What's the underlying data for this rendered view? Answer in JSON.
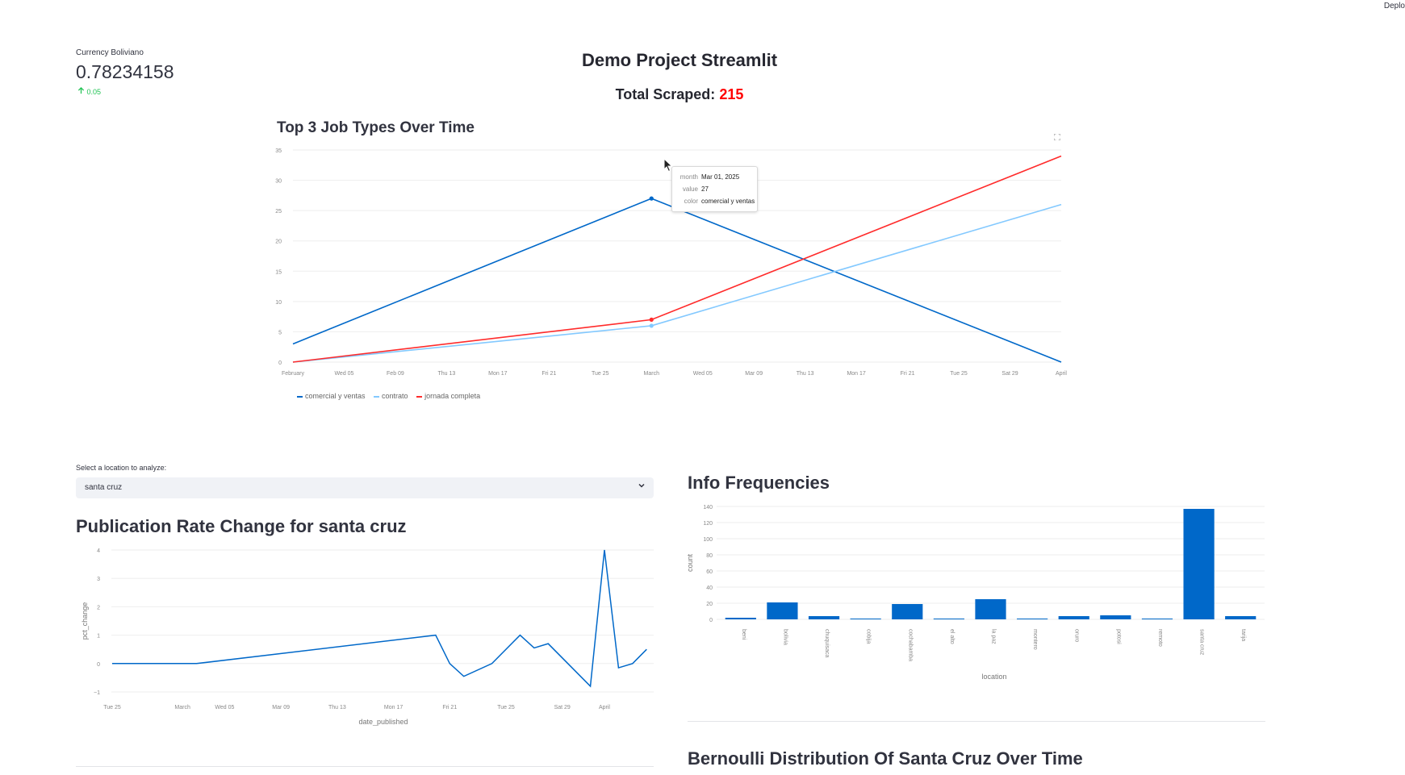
{
  "header": {
    "deploy_label": "Deplo"
  },
  "metric": {
    "label": "Currency Boliviano",
    "value": "0.78234158",
    "delta": "0.05",
    "delta_icon": "arrow-up-icon"
  },
  "page": {
    "title": "Demo Project Streamlit",
    "scraped_label": "Total Scraped:",
    "scraped_value": "215"
  },
  "top_chart": {
    "title": "Top 3 Job Types Over Time",
    "tooltip": {
      "k1": "month",
      "v1": "Mar 01, 2025",
      "k2": "value",
      "v2": "27",
      "k3": "color",
      "v3": "comercial y ventas"
    },
    "legend": [
      "comercial y ventas",
      "contrato",
      "jornada completa"
    ],
    "colors": [
      "#0068c9",
      "#83c9ff",
      "#ff2b2b"
    ]
  },
  "location_select": {
    "label": "Select a location to analyze:",
    "value": "santa cruz"
  },
  "pub_chart": {
    "title": "Publication Rate Change for santa cruz"
  },
  "freq_chart": {
    "title": "Info Frequencies"
  },
  "bernoulli": {
    "title": "Bernoulli Distribution Of Santa Cruz Over Time"
  },
  "chart_data": [
    {
      "type": "line",
      "title": "Top 3 Job Types Over Time",
      "x_ticks": [
        "February",
        "Wed 05",
        "Feb 09",
        "Thu 13",
        "Mon 17",
        "Fri 21",
        "Tue 25",
        "March",
        "Wed 05",
        "Mar 09",
        "Thu 13",
        "Mon 17",
        "Fri 21",
        "Tue 25",
        "Sat 29",
        "April"
      ],
      "x": [
        "Feb 01, 2025",
        "Mar 01, 2025",
        "Apr 01, 2025"
      ],
      "ylim": [
        0,
        35
      ],
      "y_ticks": [
        0,
        5,
        10,
        15,
        20,
        25,
        30,
        35
      ],
      "series": [
        {
          "name": "comercial y ventas",
          "values": [
            3,
            27,
            0
          ]
        },
        {
          "name": "contrato",
          "values": [
            0,
            6,
            26
          ]
        },
        {
          "name": "jornada completa",
          "values": [
            0,
            7,
            34
          ]
        }
      ]
    },
    {
      "type": "line",
      "title": "Publication Rate Change for santa cruz",
      "xlabel": "date_published",
      "ylabel": "pct_change",
      "x_ticks": [
        "Tue 25",
        "March",
        "Wed 05",
        "Mar 09",
        "Thu 13",
        "Mon 17",
        "Fri 21",
        "Tue 25",
        "Sat 29",
        "April"
      ],
      "ylim": [
        -1,
        4
      ],
      "y_ticks": [
        -1,
        0,
        1,
        2,
        3,
        4
      ],
      "x": [
        "Feb 25",
        "Feb 27",
        "Mar 01",
        "Mar 03",
        "Mar 20",
        "Mar 21",
        "Mar 22",
        "Mar 24",
        "Mar 26",
        "Mar 27",
        "Mar 28",
        "Mar 31",
        "Apr 01",
        "Apr 02",
        "Apr 03",
        "Apr 04"
      ],
      "series": [
        {
          "name": "",
          "values": [
            0,
            0,
            0,
            0,
            1,
            0,
            -0.45,
            0,
            1,
            0.55,
            0.7,
            -0.8,
            4,
            -0.15,
            0,
            0.5
          ]
        }
      ]
    },
    {
      "type": "bar",
      "title": "Info Frequencies",
      "xlabel": "location",
      "ylabel": "count",
      "ylim": [
        0,
        140
      ],
      "y_ticks": [
        0,
        20,
        40,
        60,
        80,
        100,
        120,
        140
      ],
      "categories": [
        "beni",
        "bolivia",
        "chuquisaca",
        "cobija",
        "cochabamba",
        "el alto",
        "la paz",
        "montero",
        "oruro",
        "potosi",
        "remoto",
        "santa cruz",
        "tarija"
      ],
      "values": [
        2,
        21,
        4,
        1,
        19,
        1,
        25,
        1,
        4,
        5,
        1,
        137,
        4
      ]
    }
  ]
}
